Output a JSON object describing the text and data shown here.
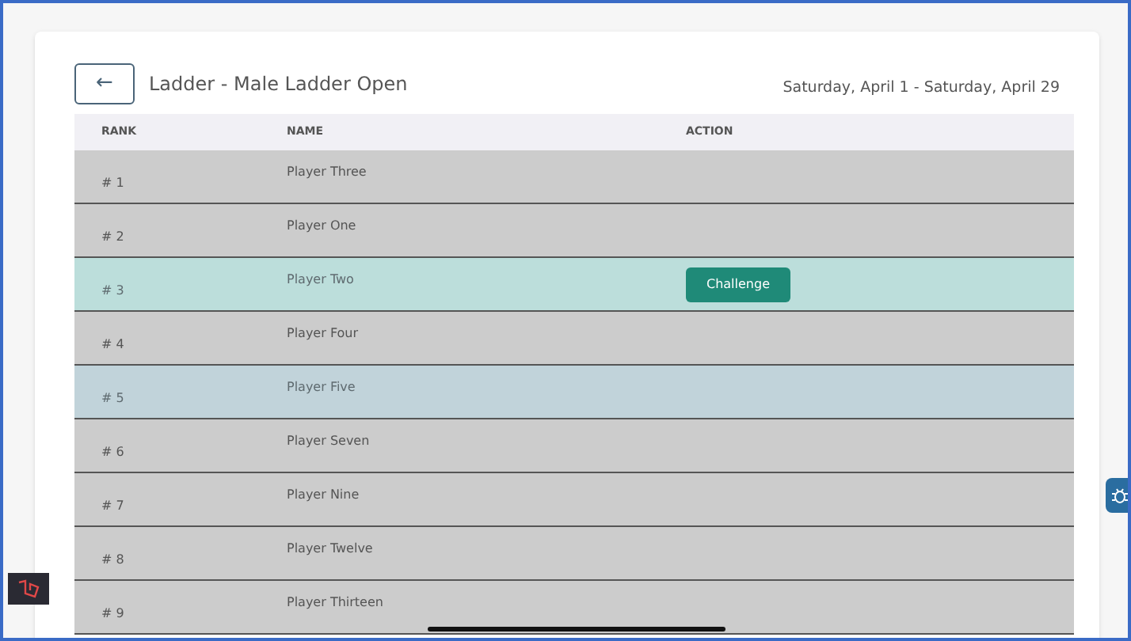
{
  "header": {
    "back_label": "←",
    "title": "Ladder - Male Ladder Open",
    "date_range": "Saturday, April 1 - Saturday, April 29"
  },
  "table": {
    "columns": [
      "RANK",
      "NAME",
      "ACTION"
    ],
    "rows": [
      {
        "kind": "plain",
        "rank": "# 1",
        "name": "Player Three"
      },
      {
        "kind": "plain",
        "rank": "# 2",
        "name": "Player One"
      },
      {
        "kind": "challengeable",
        "rank": "# 3",
        "name": "Player Two",
        "action": "Challenge"
      },
      {
        "kind": "plain",
        "rank": "# 4",
        "name": "Player Four"
      },
      {
        "kind": "self",
        "rank": "# 5",
        "name": "Player Five"
      },
      {
        "kind": "plain",
        "rank": "# 6",
        "name": "Player Seven"
      },
      {
        "kind": "plain",
        "rank": "# 7",
        "name": "Player Nine"
      },
      {
        "kind": "plain",
        "rank": "# 8",
        "name": "Player Twelve"
      },
      {
        "kind": "plain",
        "rank": "# 9",
        "name": "Player Thirteen"
      }
    ]
  }
}
